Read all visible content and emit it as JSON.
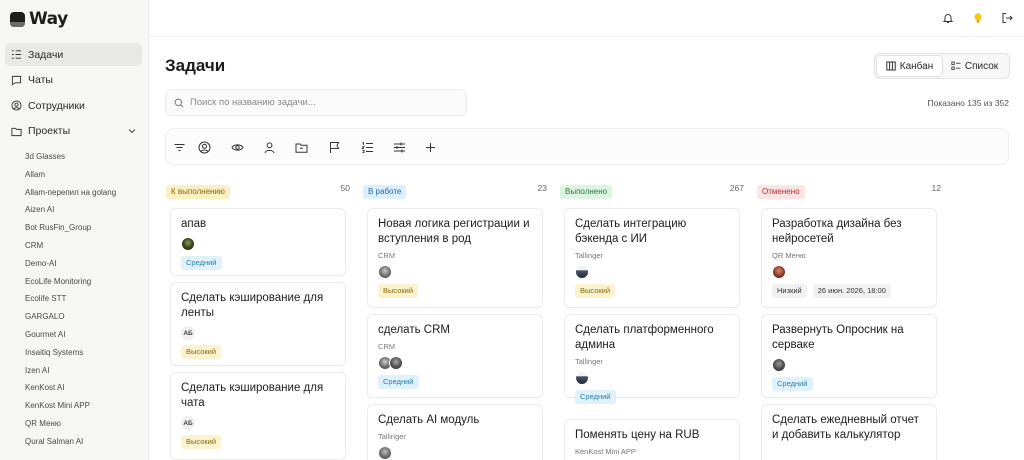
{
  "app": {
    "logo_text": "Way"
  },
  "sidebar": {
    "items": [
      {
        "label": "Задачи",
        "icon": "tasks-icon",
        "active": true
      },
      {
        "label": "Чаты",
        "icon": "chat-icon",
        "active": false
      },
      {
        "label": "Сотрудники",
        "icon": "user-circle-icon",
        "active": false
      },
      {
        "label": "Проекты",
        "icon": "folder-icon",
        "active": false
      }
    ],
    "projects": [
      "3d Glasses",
      "Allam",
      "Allam-перепил на golang",
      "Aizen AI",
      "Bot RusFin_Group",
      "CRM",
      "Demo-AI",
      "EcoLife Monitoring",
      "Ecolife STT",
      "GARGALO",
      "Gourmet AI",
      "Insaitiq Systems",
      "Izen AI",
      "KenKost AI",
      "KenKost Mini APP",
      "QR Меню",
      "Qural Salman AI"
    ]
  },
  "topbar": {
    "icons": [
      "bell-icon",
      "lightbulb-icon",
      "logout-icon"
    ],
    "accent": "#f5c518"
  },
  "main": {
    "title": "Задачи",
    "view": {
      "kanban": "Канбан",
      "list": "Список",
      "selected": "Канбан"
    },
    "search_placeholder": "Поиск по названию задачи...",
    "shown": "Показано 135 из 352",
    "toolbar_icons": [
      "filter-icon",
      "user-circle-icon",
      "eye-icon",
      "user-icon",
      "folder-icon",
      "flag-icon",
      "list-ordered-icon",
      "sliders-icon",
      "plus-icon"
    ]
  },
  "columns": [
    {
      "name": "К выполнению",
      "count": "50",
      "badge_bg": "#fbefc4",
      "badge_fg": "#8a6a07",
      "cards": [
        {
          "title": "апав",
          "project": "",
          "avatars": [
            "photo"
          ],
          "tags": [
            {
              "label": "Средний",
              "kind": "mid"
            }
          ]
        },
        {
          "title": "Сделать кэширование для ленты",
          "project": "",
          "avatars": [
            "АБ"
          ],
          "tags": [
            {
              "label": "Высокий",
              "kind": "high"
            }
          ]
        },
        {
          "title": "Сделать кэширование для чата",
          "project": "",
          "avatars": [
            "АБ"
          ],
          "tags": [
            {
              "label": "Высокий",
              "kind": "high"
            }
          ]
        }
      ]
    },
    {
      "name": "В работе",
      "count": "23",
      "badge_bg": "#dcefff",
      "badge_fg": "#2566a8",
      "cards": [
        {
          "title": "Новая логика регистрации и вступления в род",
          "project": "CRM",
          "avatars": [
            "photo"
          ],
          "tags": [
            {
              "label": "Высокий",
              "kind": "high"
            }
          ]
        },
        {
          "title": "сделать CRM",
          "project": "CRM",
          "avatars": [
            "photo",
            "photo"
          ],
          "tags": [
            {
              "label": "Средний",
              "kind": "mid"
            }
          ]
        },
        {
          "title": "Сделать AI модуль",
          "project": "Tallinger",
          "avatars": [
            "photo"
          ],
          "tags": []
        }
      ]
    },
    {
      "name": "Выполнено",
      "count": "267",
      "badge_bg": "#dbf5e1",
      "badge_fg": "#2b7a3e",
      "cards": [
        {
          "title": "Сделать интеграцию бэкенда с ИИ",
          "project": "Tallinger",
          "avatars": [
            "photo"
          ],
          "tags": [
            {
              "label": "Высокий",
              "kind": "high"
            }
          ]
        },
        {
          "title": "Сделать платформенного админа",
          "project": "Tallinger",
          "avatars": [
            "photo"
          ],
          "tags": [
            {
              "label": "Средний",
              "kind": "mid"
            }
          ]
        },
        {
          "title": "Поменять цену на RUB",
          "project": "KenKost Mini APP",
          "avatars": [],
          "tags": []
        }
      ]
    },
    {
      "name": "Отменено",
      "count": "12",
      "badge_bg": "#fde3e3",
      "badge_fg": "#b23030",
      "cards": [
        {
          "title": "Разработка дизайна без нейросетей",
          "project": "QR Меню",
          "avatars": [
            "photo"
          ],
          "tags": [
            {
              "label": "Низкий",
              "kind": "low"
            },
            {
              "label": "26 июн. 2026, 18:00",
              "kind": "date"
            }
          ]
        },
        {
          "title": "Развернуть Опросник на серваке",
          "project": "",
          "avatars": [
            "photo"
          ],
          "tags": [
            {
              "label": "Средний",
              "kind": "mid"
            }
          ]
        },
        {
          "title": "Сделать ежедневный отчет и добавить калькулятор",
          "project": "",
          "avatars": [],
          "tags": []
        }
      ]
    }
  ]
}
